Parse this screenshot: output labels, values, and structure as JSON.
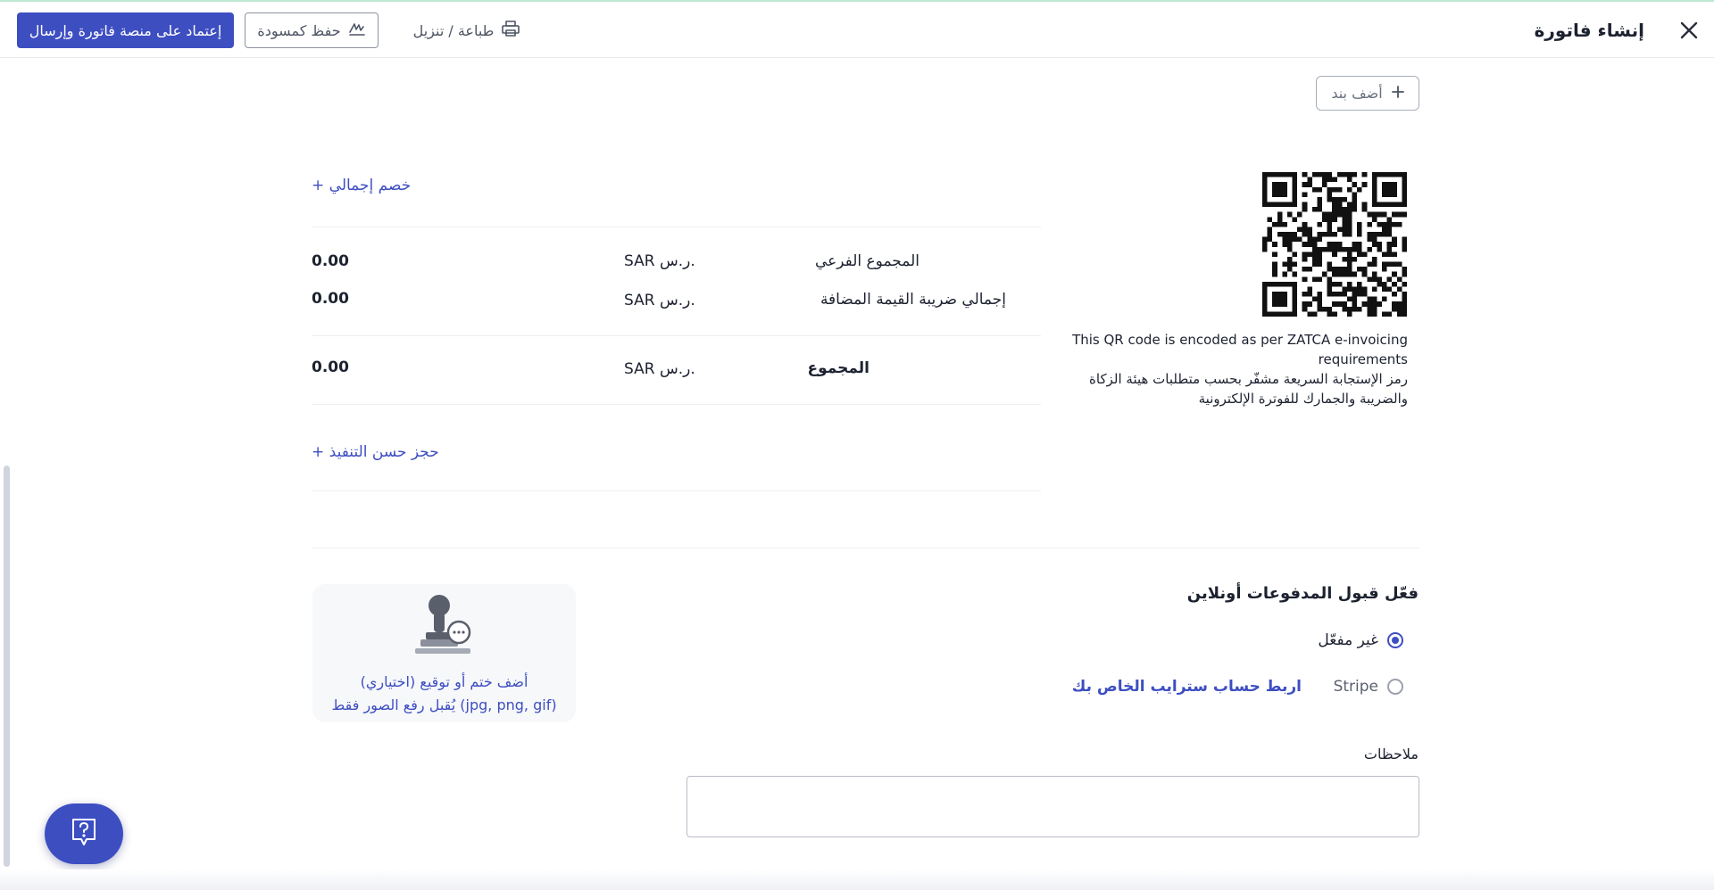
{
  "header": {
    "title": "إنشاء فاتورة",
    "approve_button": "إعتماد على منصة فاتورة وإرسال",
    "save_draft_button": "حفظ كمسودة",
    "print_button": "طباعة / تنزيل"
  },
  "items": {
    "add_item_label": "أضف بند"
  },
  "totals": {
    "discount_link": "+ خصم إجمالي",
    "retention_link": "+ حجز حسن التنفيذ",
    "rows": [
      {
        "label": "المجموع الفرعي",
        "currency": "SAR ر.س.",
        "value": "0.00"
      },
      {
        "label": "إجمالي ضريبة القيمة المضافة",
        "currency": "SAR ر.س.",
        "value": "0.00"
      },
      {
        "label": "المجموع",
        "currency": "SAR ر.س.",
        "value": "0.00"
      }
    ]
  },
  "qr": {
    "caption_en": "This QR code is encoded as per ZATCA e-invoicing requirements",
    "caption_ar": "رمز الإستجابة السريعة مشفّر بحسب متطلبات هيئة الزكاة والضريبة والجمارك للفوترة الإلكترونية"
  },
  "payments": {
    "title": "فعّل قبول المدفوعات أونلاين",
    "options": [
      {
        "label": "غير مفعّل",
        "checked": true
      },
      {
        "label": "Stripe",
        "checked": false
      }
    ],
    "stripe_connect_link": "اربط حساب سترايب الخاص بك"
  },
  "stamp": {
    "line1": "(اختياري) أضف ختم أو توقيع",
    "line2": "يُقبل رفع الصور فقط (jpg, png, gif)"
  },
  "notes": {
    "label": "ملاحظات",
    "value": ""
  },
  "colors": {
    "primary": "#3d4ec1",
    "text": "#1d2230",
    "border": "#b9bdc7"
  },
  "icons": {
    "close": "close-icon",
    "draft": "signature-icon",
    "print": "printer-icon",
    "add": "plus-icon",
    "stamp": "stamp-icon",
    "help": "help-icon"
  }
}
